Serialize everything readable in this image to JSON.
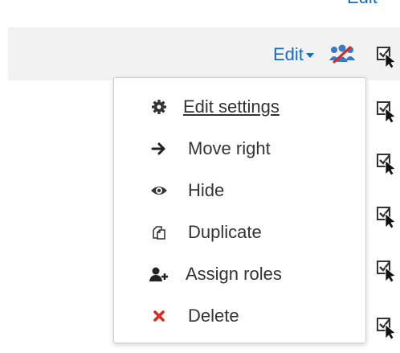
{
  "top": {
    "edit_label": "Edit"
  },
  "row": {
    "edit_label": "Edit"
  },
  "menu": {
    "items": [
      {
        "label": " Edit settings",
        "icon": "gear-icon"
      },
      {
        "label": "Move right",
        "icon": "arrow-right-icon"
      },
      {
        "label": "Hide",
        "icon": "eye-icon"
      },
      {
        "label": "Duplicate",
        "icon": "duplicate-icon"
      },
      {
        "label": "Assign roles",
        "icon": "add-user-icon"
      },
      {
        "label": "Delete",
        "icon": "delete-icon"
      }
    ]
  },
  "colors": {
    "link": "#0f6fc5",
    "delete": "#d9281f",
    "text": "#333333",
    "group_icon": "#3a78c2",
    "group_slash": "#d9281f"
  }
}
